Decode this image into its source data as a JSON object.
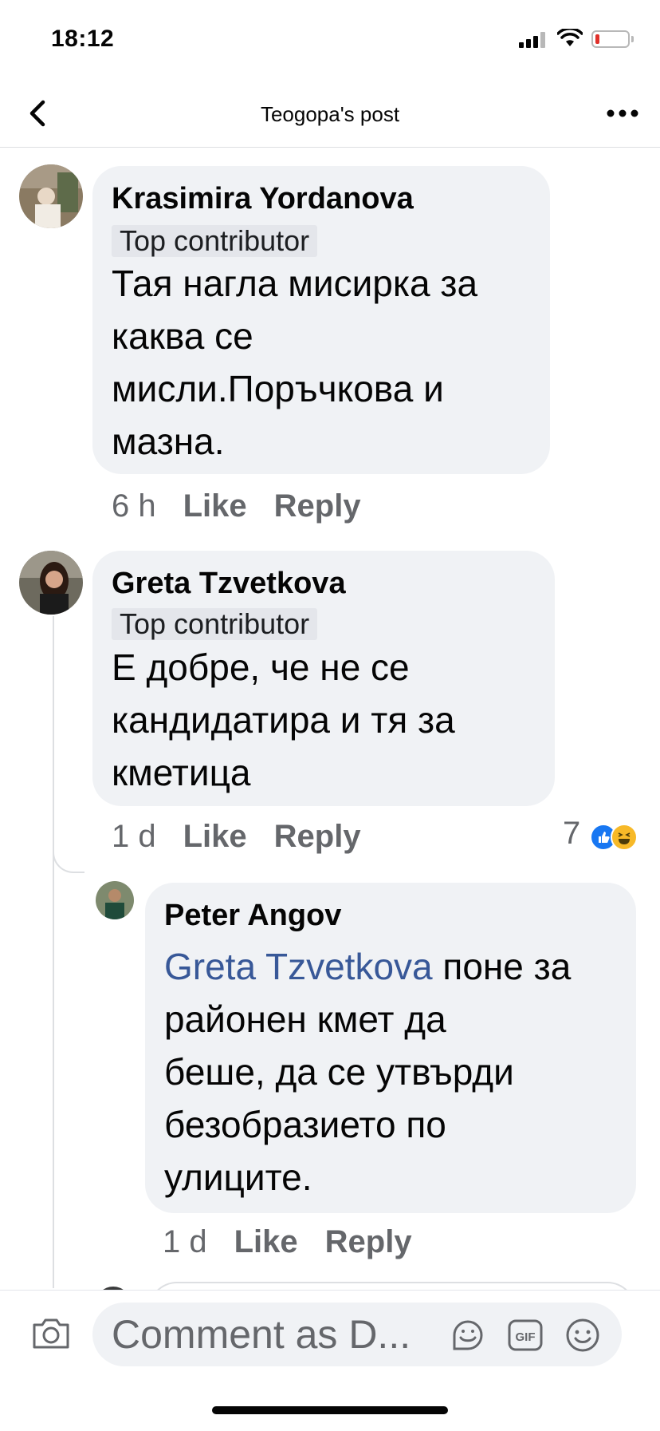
{
  "status_bar": {
    "time": "18:12"
  },
  "nav": {
    "title": "Teogopa's post"
  },
  "comments": [
    {
      "author": "Krasimira Yordanova",
      "badge": "Top contributor",
      "text_lines": [
        "Тая нагла мисирка за",
        "каква се",
        "мисли.Поръчкова и",
        "мазна."
      ],
      "time": "6 h",
      "like": "Like",
      "reply": "Reply"
    },
    {
      "author": "Greta Tzvetkova",
      "badge": "Top contributor",
      "text_lines": [
        "Е добре, че не се",
        "кандидатира и тя за",
        "кметица"
      ],
      "time": "1 d",
      "like": "Like",
      "reply": "Reply",
      "reaction_count": "7",
      "reaction_icons": [
        "like-icon",
        "haha-icon"
      ]
    }
  ],
  "reply": {
    "author": "Peter Angov",
    "mention": "Greta Tzvetkova",
    "text_first_rest": " поне за",
    "text_lines": [
      "районен кмет да",
      "беше, да се утвърди",
      "безобразието по",
      "улиците."
    ],
    "time": "1 d",
    "like": "Like",
    "reply": "Reply"
  },
  "composer": {
    "placeholder": "Comment as D...",
    "icons": [
      "camera-icon",
      "sticker-icon",
      "gif-icon",
      "emoji-icon"
    ],
    "gif_label": "GIF"
  },
  "colors": {
    "mention": "#385898",
    "bubble": "#f0f2f5",
    "like_blue": "#1877f2",
    "haha_yellow": "#f7b928"
  }
}
